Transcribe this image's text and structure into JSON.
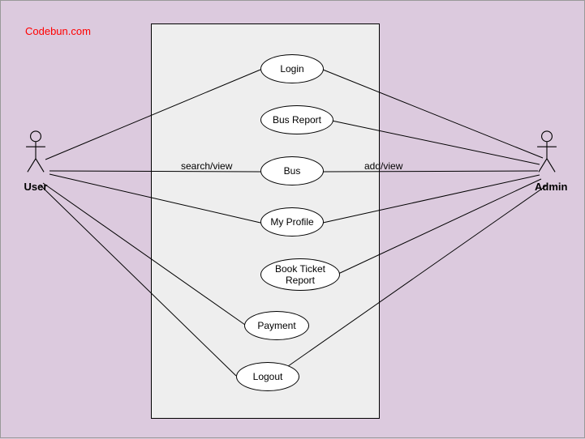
{
  "watermark": "Codebun.com",
  "actors": {
    "user": {
      "label": "User"
    },
    "admin": {
      "label": "Admin"
    }
  },
  "usecases": {
    "login": "Login",
    "bus_report": "Bus Report",
    "bus": "Bus",
    "my_profile": "My Profile",
    "book_ticket_report": "Book Ticket\nReport",
    "payment": "Payment",
    "logout": "Logout"
  },
  "edge_labels": {
    "user_bus": "search/view",
    "admin_bus": "add/view"
  }
}
